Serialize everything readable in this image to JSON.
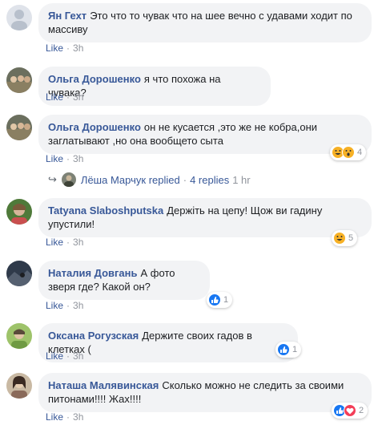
{
  "comments": [
    {
      "author": "Ян Гехт",
      "text": "Это что то чувак что на шее вечно с удавами ходит по массиву",
      "like": "Like",
      "time": "3h"
    },
    {
      "author": "Ольга Дорошенко",
      "text": "я что похожа на чувака?",
      "like": "Like",
      "time": "3h"
    },
    {
      "author": "Ольга Дорошенко",
      "text": "он не кусается ,это же не кобра,они заглатывают ,но она вообщето сыта",
      "like": "Like",
      "time": "3h",
      "reactions": "4"
    },
    {
      "author": "Tatyana Slaboshputska",
      "text": "Держіть на цепу! Щож ви гадину упустили!",
      "like": "Like",
      "time": "3h",
      "reactions": "5"
    },
    {
      "author": "Наталия Довгань",
      "text": "А фото зверя где? Какой он?",
      "like": "Like",
      "time": "3h",
      "reactions": "1"
    },
    {
      "author": "Оксана Рогузская",
      "text": "Держите своих гадов в клетках (",
      "like": "Like",
      "time": "3h",
      "reactions": "1"
    },
    {
      "author": "Наташа Малявинская",
      "text": "Сколько можно не следить за своими питонами!!!! Жах!!!!",
      "like": "Like",
      "time": "3h",
      "reactions": "2"
    }
  ],
  "replies": {
    "name": "Лёша Марчук",
    "action": "replied",
    "count": "4 replies",
    "time": "1 hr"
  },
  "colors": {
    "link": "#385898",
    "bubble": "#f2f3f5",
    "meta": "#90949c"
  }
}
